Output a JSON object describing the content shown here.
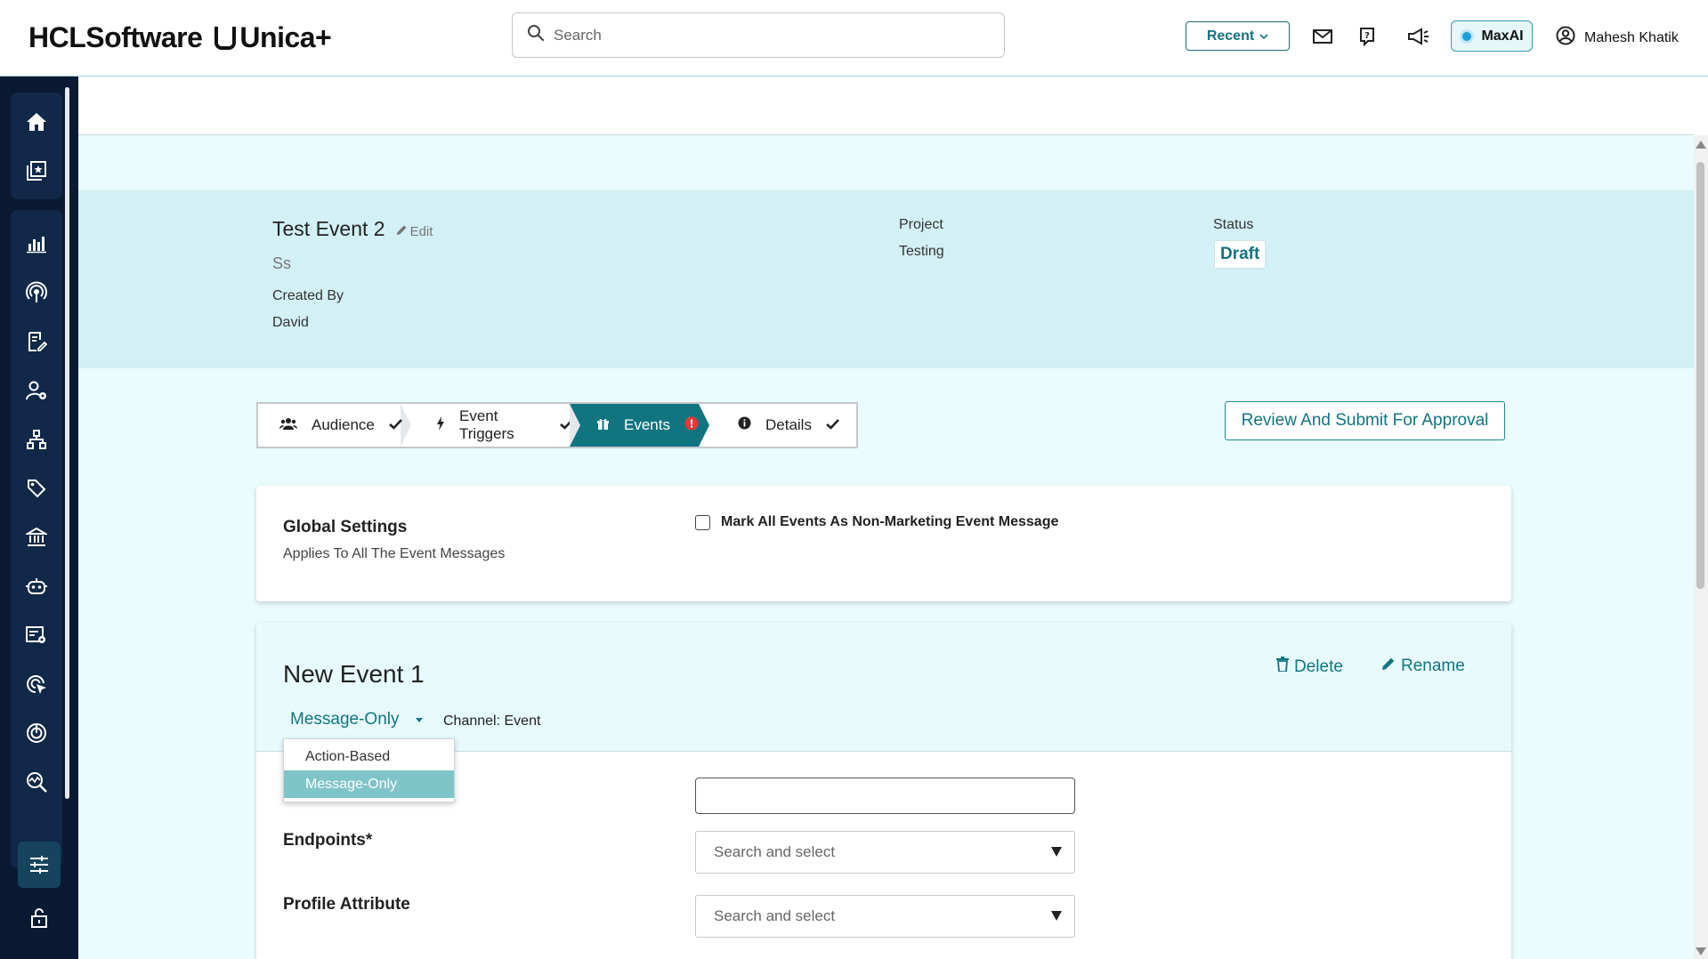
{
  "header": {
    "brand": "HCLSoftware",
    "product": "Unica+",
    "search_placeholder": "Search",
    "recent_label": "Recent",
    "maxai_label": "MaxAI",
    "user_name": "Mahesh Khatik"
  },
  "event_info": {
    "title": "Test Event 2",
    "edit_label": "Edit",
    "description": "Ss",
    "created_by_label": "Created By",
    "created_by_value": "David",
    "project_label": "Project",
    "project_value": "Testing",
    "status_label": "Status",
    "status_value": "Draft"
  },
  "stepper": {
    "steps": [
      {
        "label": "Audience",
        "state": "complete"
      },
      {
        "label": "Event Triggers",
        "state": "complete"
      },
      {
        "label": "Events",
        "state": "error"
      },
      {
        "label": "Details",
        "state": "complete"
      }
    ],
    "review_button": "Review And Submit For Approval"
  },
  "global_settings": {
    "title": "Global Settings",
    "subtitle": "Applies To All The Event Messages",
    "checkbox_label": "Mark All Events As Non-Marketing Event Message"
  },
  "event_card": {
    "name": "New Event 1",
    "delete_label": "Delete",
    "rename_label": "Rename",
    "type_selected": "Message-Only",
    "channel_label": "Channel: Event",
    "type_options": [
      "Action-Based",
      "Message-Only"
    ],
    "endpoints_label": "Endpoints*",
    "endpoints_placeholder": "Search and select",
    "profile_label": "Profile Attribute",
    "profile_placeholder": "Search and select"
  },
  "colors": {
    "accent": "#117580",
    "sidebar": "#0a1a33",
    "band": "#d3f0f4",
    "error": "#e53935"
  }
}
